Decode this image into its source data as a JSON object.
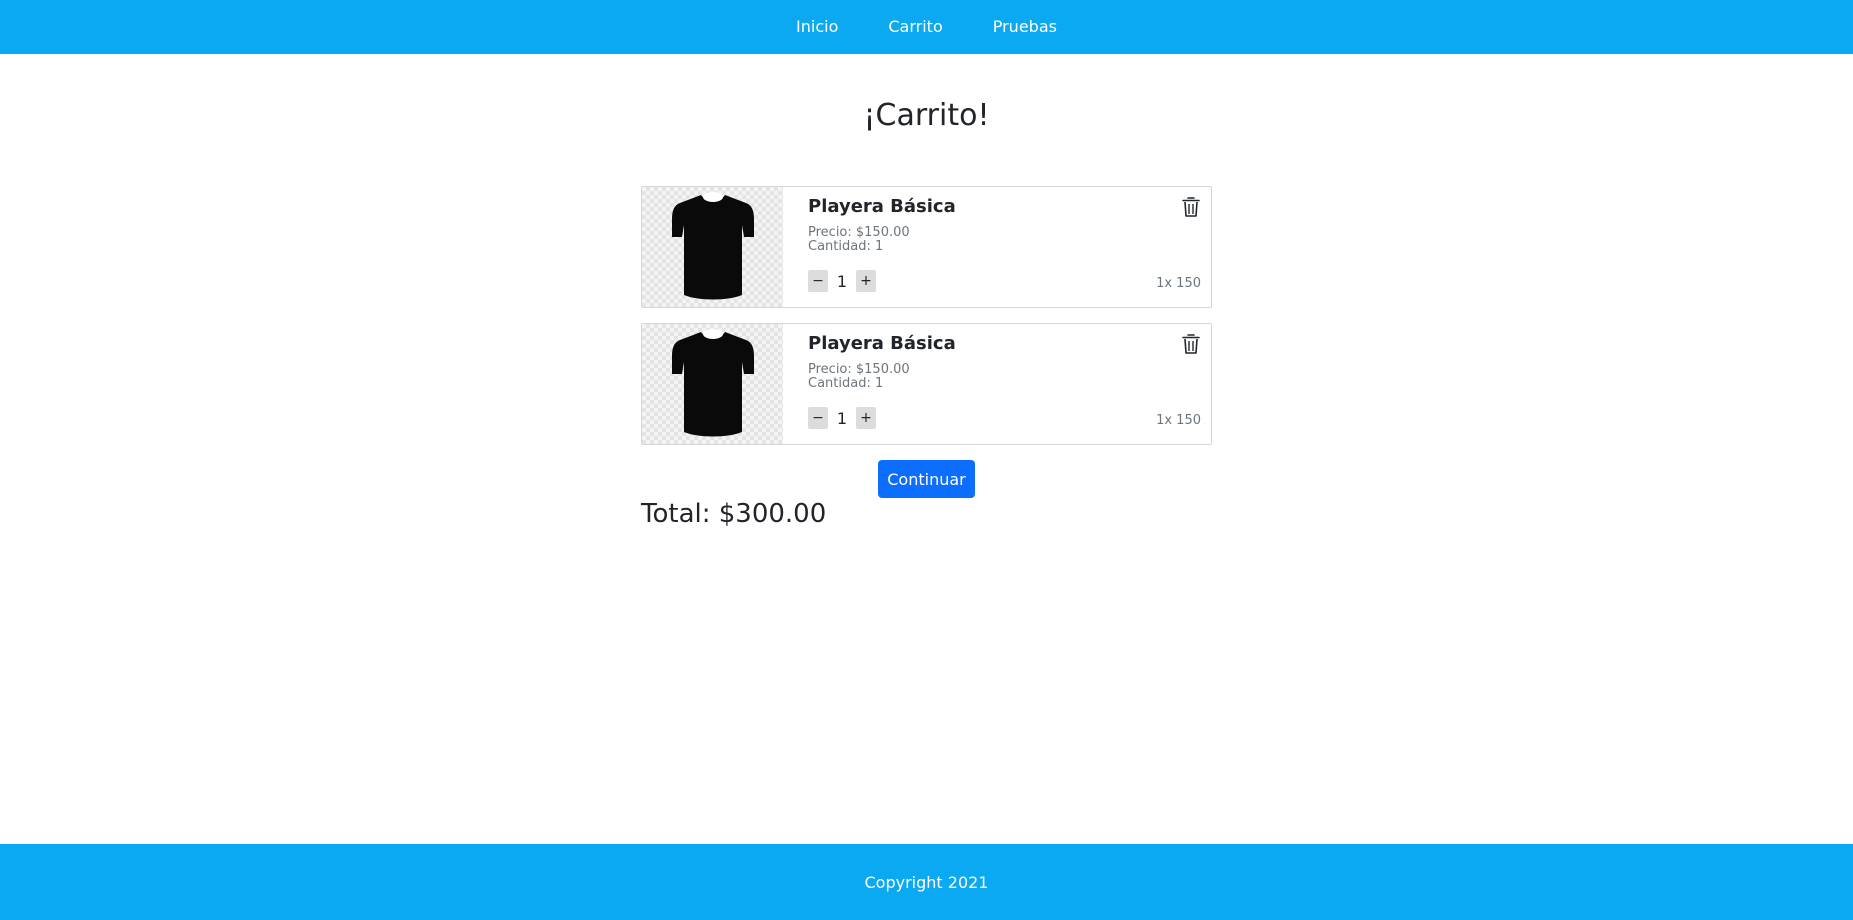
{
  "nav": {
    "links": [
      {
        "label": "Inicio"
      },
      {
        "label": "Carrito"
      },
      {
        "label": "Pruebas"
      }
    ]
  },
  "page": {
    "title": "¡Carrito!"
  },
  "cart": {
    "items": [
      {
        "name": "Playera Básica",
        "price_text": "Precio: $150.00",
        "qty_text": "Cantidad: 1",
        "quantity": "1",
        "line_total": "1x 150",
        "decrement_label": "−",
        "increment_label": "+",
        "image_icon": "tshirt-icon",
        "delete_icon": "trash-icon"
      },
      {
        "name": "Playera Básica",
        "price_text": "Precio: $150.00",
        "qty_text": "Cantidad: 1",
        "quantity": "1",
        "line_total": "1x 150",
        "decrement_label": "−",
        "increment_label": "+",
        "image_icon": "tshirt-icon",
        "delete_icon": "trash-icon"
      }
    ],
    "continue_label": "Continuar",
    "total_text": "Total: $300.00"
  },
  "footer": {
    "text": "Copyright 2021"
  },
  "colors": {
    "nav_bg": "#0ba9f2",
    "primary_button": "#0d6efd",
    "text": "#212529",
    "muted": "#6c757d"
  }
}
